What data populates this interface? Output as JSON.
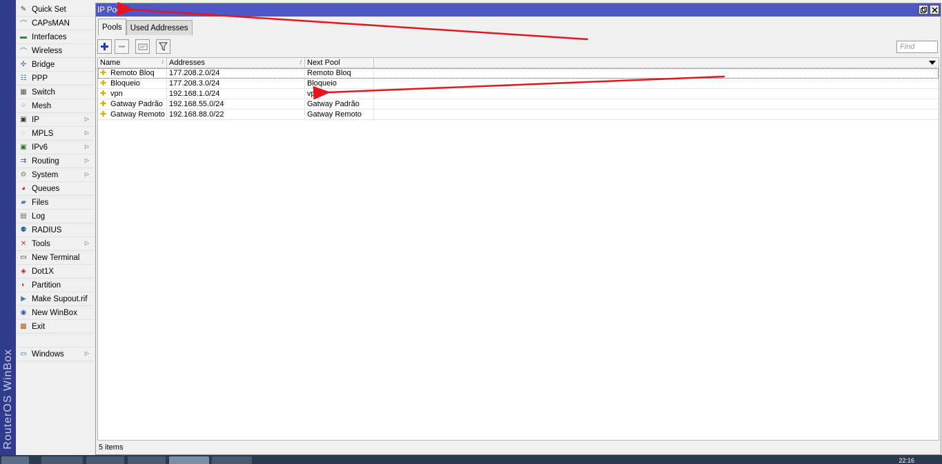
{
  "brand": {
    "text": "RouterOS WinBox"
  },
  "sidebar": {
    "items": [
      {
        "label": "Quick Set",
        "icon": "wand-icon",
        "submenu": false
      },
      {
        "label": "CAPsMAN",
        "icon": "antenna-icon",
        "submenu": false
      },
      {
        "label": "Interfaces",
        "icon": "interfaces-icon",
        "submenu": false
      },
      {
        "label": "Wireless",
        "icon": "wireless-icon",
        "submenu": false
      },
      {
        "label": "Bridge",
        "icon": "bridge-icon",
        "submenu": false
      },
      {
        "label": "PPP",
        "icon": "ppp-icon",
        "submenu": false
      },
      {
        "label": "Switch",
        "icon": "switch-icon",
        "submenu": false
      },
      {
        "label": "Mesh",
        "icon": "mesh-icon",
        "submenu": false
      },
      {
        "label": "IP",
        "icon": "ip-icon",
        "submenu": true
      },
      {
        "label": "MPLS",
        "icon": "mpls-icon",
        "submenu": true
      },
      {
        "label": "IPv6",
        "icon": "ipv6-icon",
        "submenu": true
      },
      {
        "label": "Routing",
        "icon": "routing-icon",
        "submenu": true
      },
      {
        "label": "System",
        "icon": "gear-icon",
        "submenu": true
      },
      {
        "label": "Queues",
        "icon": "queues-icon",
        "submenu": false
      },
      {
        "label": "Files",
        "icon": "folder-icon",
        "submenu": false
      },
      {
        "label": "Log",
        "icon": "log-icon",
        "submenu": false
      },
      {
        "label": "RADIUS",
        "icon": "radius-icon",
        "submenu": false
      },
      {
        "label": "Tools",
        "icon": "tools-icon",
        "submenu": true
      },
      {
        "label": "New Terminal",
        "icon": "terminal-icon",
        "submenu": false
      },
      {
        "label": "Dot1X",
        "icon": "dot1x-icon",
        "submenu": false
      },
      {
        "label": "Partition",
        "icon": "partition-icon",
        "submenu": false
      },
      {
        "label": "Make Supout.rif",
        "icon": "supout-icon",
        "submenu": false
      },
      {
        "label": "New WinBox",
        "icon": "winbox-icon",
        "submenu": false
      },
      {
        "label": "Exit",
        "icon": "exit-icon",
        "submenu": false
      }
    ],
    "windows_item": {
      "label": "Windows",
      "icon": "windows-icon",
      "submenu": true
    }
  },
  "window": {
    "title": "IP Pool",
    "tabs": [
      {
        "label": "Pools",
        "active": true
      },
      {
        "label": "Used Addresses",
        "active": false
      }
    ],
    "toolbar": {
      "add": "+",
      "remove": "−",
      "find_placeholder": "Find"
    },
    "table": {
      "columns": [
        "Name",
        "Addresses",
        "Next Pool"
      ],
      "rows": [
        {
          "name": "Remoto Bloq",
          "addresses": "177.208.2.0/24",
          "next_pool": "Remoto Bloq"
        },
        {
          "name": "Bloqueio",
          "addresses": "177.208.3.0/24",
          "next_pool": "Bloqueio"
        },
        {
          "name": "vpn",
          "addresses": "192.168.1.0/24",
          "next_pool": "vpn"
        },
        {
          "name": "Gatway Padrão",
          "addresses": "192.168.55.0/24",
          "next_pool": "Gatway Padrão"
        },
        {
          "name": "Gatway Remoto",
          "addresses": "192.168.88.0/22",
          "next_pool": "Gatway Remoto"
        }
      ]
    },
    "status": "5 items"
  },
  "taskbar": {
    "clock": "22:16"
  },
  "colors": {
    "titlebar": "#4f57c6",
    "brand_bar": "#2f3b8c",
    "annotation_arrow": "#e8141c"
  }
}
